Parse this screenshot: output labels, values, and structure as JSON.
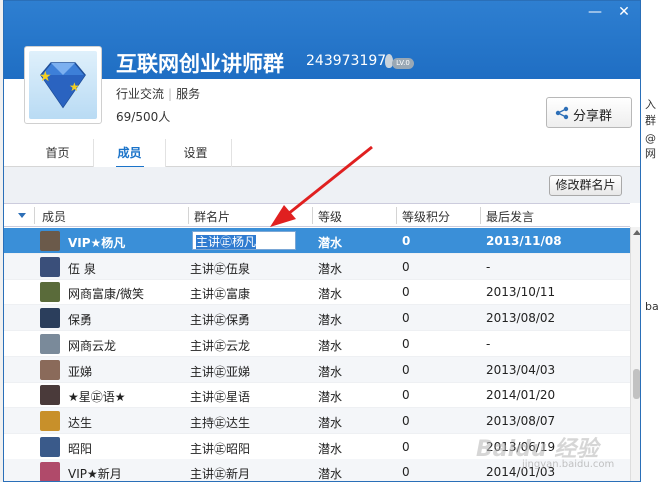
{
  "window": {
    "minimize": "—",
    "close": "✕"
  },
  "group": {
    "name": "互联网创业讲师群",
    "id": "243973197",
    "level_badge": "LV.0",
    "category1": "行业交流",
    "category2": "服务",
    "member_count": "69/500人",
    "share_label": "分享群"
  },
  "tabs": [
    {
      "label": "首页",
      "active": false
    },
    {
      "label": "成员",
      "active": true
    },
    {
      "label": "设置",
      "active": false
    }
  ],
  "toolbar": {
    "modify_card_label": "修改群名片"
  },
  "columns": [
    "成员",
    "群名片",
    "等级",
    "等级积分",
    "最后发言"
  ],
  "rows": [
    {
      "member": "VIP★杨凡",
      "card": "主讲㊣杨凡",
      "level": "潜水",
      "points": "0",
      "last": "2013/11/08",
      "selected": true,
      "avatar_color": "#6b5a4a"
    },
    {
      "member": "伍 泉",
      "card": "主讲㊣伍泉",
      "level": "潜水",
      "points": "0",
      "last": "-",
      "selected": false,
      "avatar_color": "#3a4f7a"
    },
    {
      "member": "网商富康/微笑",
      "card": "主讲㊣富康",
      "level": "潜水",
      "points": "0",
      "last": "2013/10/11",
      "selected": false,
      "avatar_color": "#5a6b3a"
    },
    {
      "member": "保勇",
      "card": "主讲㊣保勇",
      "level": "潜水",
      "points": "0",
      "last": "2013/08/02",
      "selected": false,
      "avatar_color": "#2b3e5c"
    },
    {
      "member": "网商云龙",
      "card": "主讲㊣云龙",
      "level": "潜水",
      "points": "0",
      "last": "-",
      "selected": false,
      "avatar_color": "#7a8a9a"
    },
    {
      "member": "亚娣",
      "card": "主讲㊣亚娣",
      "level": "潜水",
      "points": "0",
      "last": "2013/04/03",
      "selected": false,
      "avatar_color": "#8a6a5a"
    },
    {
      "member": "★星㊣语★",
      "card": "主讲㊣星语",
      "level": "潜水",
      "points": "0",
      "last": "2014/01/20",
      "selected": false,
      "avatar_color": "#4a3a3a"
    },
    {
      "member": "达生",
      "card": "主持㊣达生",
      "level": "潜水",
      "points": "0",
      "last": "2013/08/07",
      "selected": false,
      "avatar_color": "#c8902a"
    },
    {
      "member": "昭阳",
      "card": "主讲㊣昭阳",
      "level": "潜水",
      "points": "0",
      "last": "2013/06/19",
      "selected": false,
      "avatar_color": "#3a5a8a"
    },
    {
      "member": "VIP★新月",
      "card": "主讲㊣新月",
      "level": "潜水",
      "points": "0",
      "last": "2014/01/03",
      "selected": false,
      "avatar_color": "#b04a6a"
    }
  ],
  "edit_value": "主讲㊣杨凡",
  "bg_right_text": [
    "入群",
    "@网",
    "ba"
  ],
  "watermark": "Baidu 经验",
  "watermark_sub": "jingyan.baidu.com",
  "colors": {
    "header_blue": "#2e7fd1",
    "selected_row": "#3a8fd8",
    "accent": "#1a73c9",
    "arrow_red": "#e02020"
  }
}
